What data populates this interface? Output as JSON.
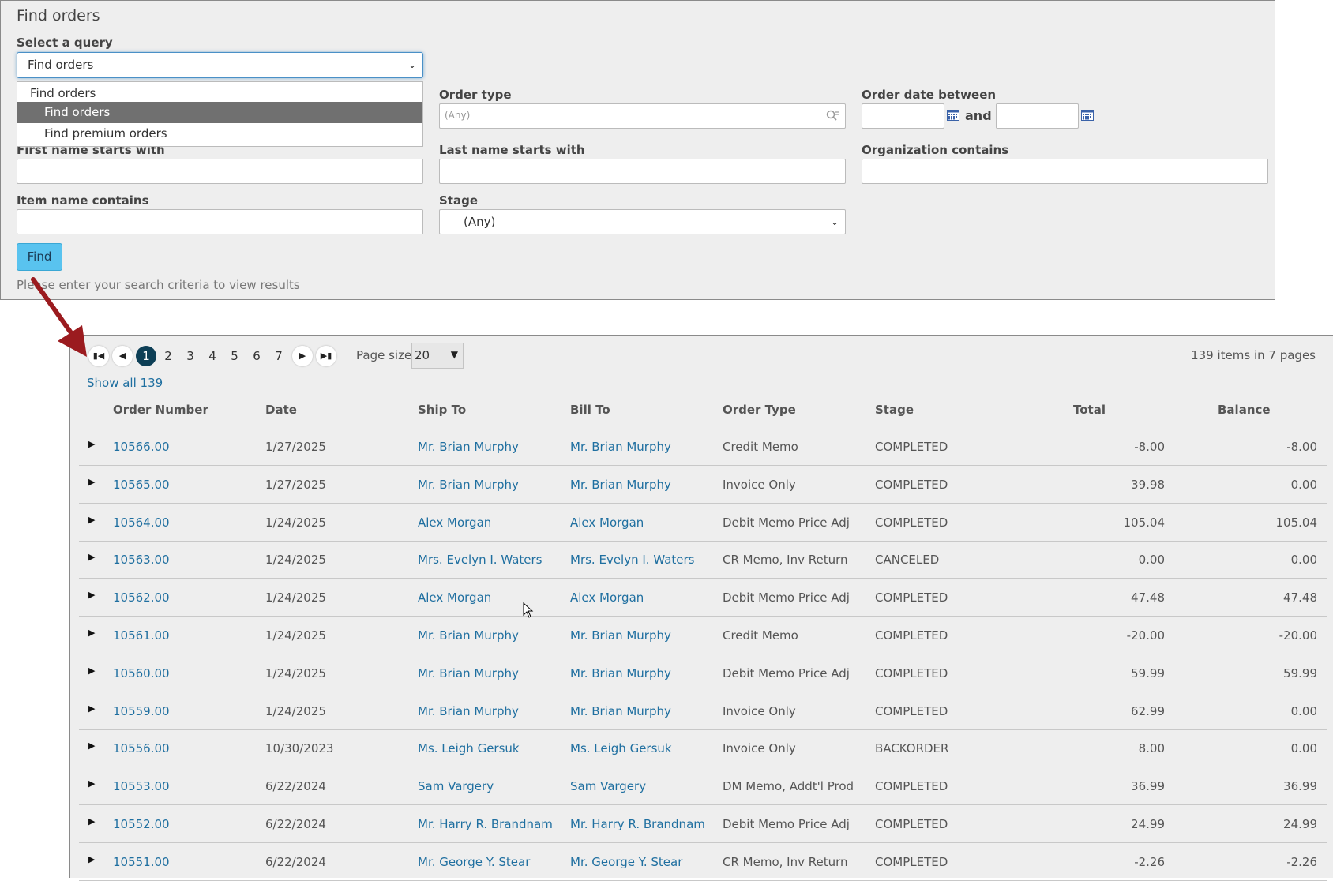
{
  "search": {
    "title": "Find orders",
    "query_label": "Select a query",
    "query_selected": "Find orders",
    "query_dropdown": {
      "group": "Find orders",
      "options": [
        "Find orders",
        "Find premium orders"
      ]
    },
    "order_type_label": "Order type",
    "order_type_placeholder": "(Any)",
    "order_date_label": "Order date between",
    "order_date_and": "and",
    "first_name_label": "First name starts with",
    "last_name_label": "Last name starts with",
    "organization_label": "Organization contains",
    "item_name_label": "Item name contains",
    "stage_label": "Stage",
    "stage_value": "(Any)",
    "find_button": "Find",
    "hint": "Please enter your search criteria to view results"
  },
  "pager": {
    "pages": [
      "1",
      "2",
      "3",
      "4",
      "5",
      "6",
      "7"
    ],
    "current_page": "1",
    "page_size_label": "Page size:",
    "page_size_value": "20",
    "items_info": "139 items in 7 pages",
    "show_all": "Show all 139"
  },
  "table": {
    "headers": [
      "Order Number",
      "Date",
      "Ship To",
      "Bill To",
      "Order Type",
      "Stage",
      "Total",
      "Balance"
    ],
    "rows": [
      [
        "10566.00",
        "1/27/2025",
        "Mr. Brian Murphy",
        "Mr. Brian Murphy",
        "Credit Memo",
        "COMPLETED",
        "-8.00",
        "-8.00"
      ],
      [
        "10565.00",
        "1/27/2025",
        "Mr. Brian Murphy",
        "Mr. Brian Murphy",
        "Invoice Only",
        "COMPLETED",
        "39.98",
        "0.00"
      ],
      [
        "10564.00",
        "1/24/2025",
        "Alex Morgan",
        "Alex Morgan",
        "Debit Memo Price Adj",
        "COMPLETED",
        "105.04",
        "105.04"
      ],
      [
        "10563.00",
        "1/24/2025",
        "Mrs. Evelyn I. Waters",
        "Mrs. Evelyn I. Waters",
        "CR Memo, Inv Return",
        "CANCELED",
        "0.00",
        "0.00"
      ],
      [
        "10562.00",
        "1/24/2025",
        "Alex Morgan",
        "Alex Morgan",
        "Debit Memo Price Adj",
        "COMPLETED",
        "47.48",
        "47.48"
      ],
      [
        "10561.00",
        "1/24/2025",
        "Mr. Brian Murphy",
        "Mr. Brian Murphy",
        "Credit Memo",
        "COMPLETED",
        "-20.00",
        "-20.00"
      ],
      [
        "10560.00",
        "1/24/2025",
        "Mr. Brian Murphy",
        "Mr. Brian Murphy",
        "Debit Memo Price Adj",
        "COMPLETED",
        "59.99",
        "59.99"
      ],
      [
        "10559.00",
        "1/24/2025",
        "Mr. Brian Murphy",
        "Mr. Brian Murphy",
        "Invoice Only",
        "COMPLETED",
        "62.99",
        "0.00"
      ],
      [
        "10556.00",
        "10/30/2023",
        "Ms. Leigh Gersuk",
        "Ms. Leigh Gersuk",
        "Invoice Only",
        "BACKORDER",
        "8.00",
        "0.00"
      ],
      [
        "10553.00",
        "6/22/2024",
        "Sam Vargery",
        "Sam Vargery",
        "DM Memo, Addt'l Prod",
        "COMPLETED",
        "36.99",
        "36.99"
      ],
      [
        "10552.00",
        "6/22/2024",
        "Mr. Harry R. Brandnam",
        "Mr. Harry R. Brandnam",
        "Debit Memo Price Adj",
        "COMPLETED",
        "24.99",
        "24.99"
      ],
      [
        "10551.00",
        "6/22/2024",
        "Mr. George Y. Stear",
        "Mr. George Y. Stear",
        "CR Memo, Inv Return",
        "COMPLETED",
        "-2.26",
        "-2.26"
      ]
    ]
  },
  "colors": {
    "panel_bg": "#eeeeee",
    "link": "#1f6fa0",
    "find_button": "#59c3ef",
    "active_page": "#0d3f56",
    "annotation_arrow": "#9b1b1f"
  },
  "icons": [
    "calendar-icon",
    "lookup-icon",
    "first-page-icon",
    "prev-page-icon",
    "next-page-icon",
    "last-page-icon",
    "expand-row-icon",
    "mouse-cursor-icon",
    "annotation-arrow-icon"
  ]
}
